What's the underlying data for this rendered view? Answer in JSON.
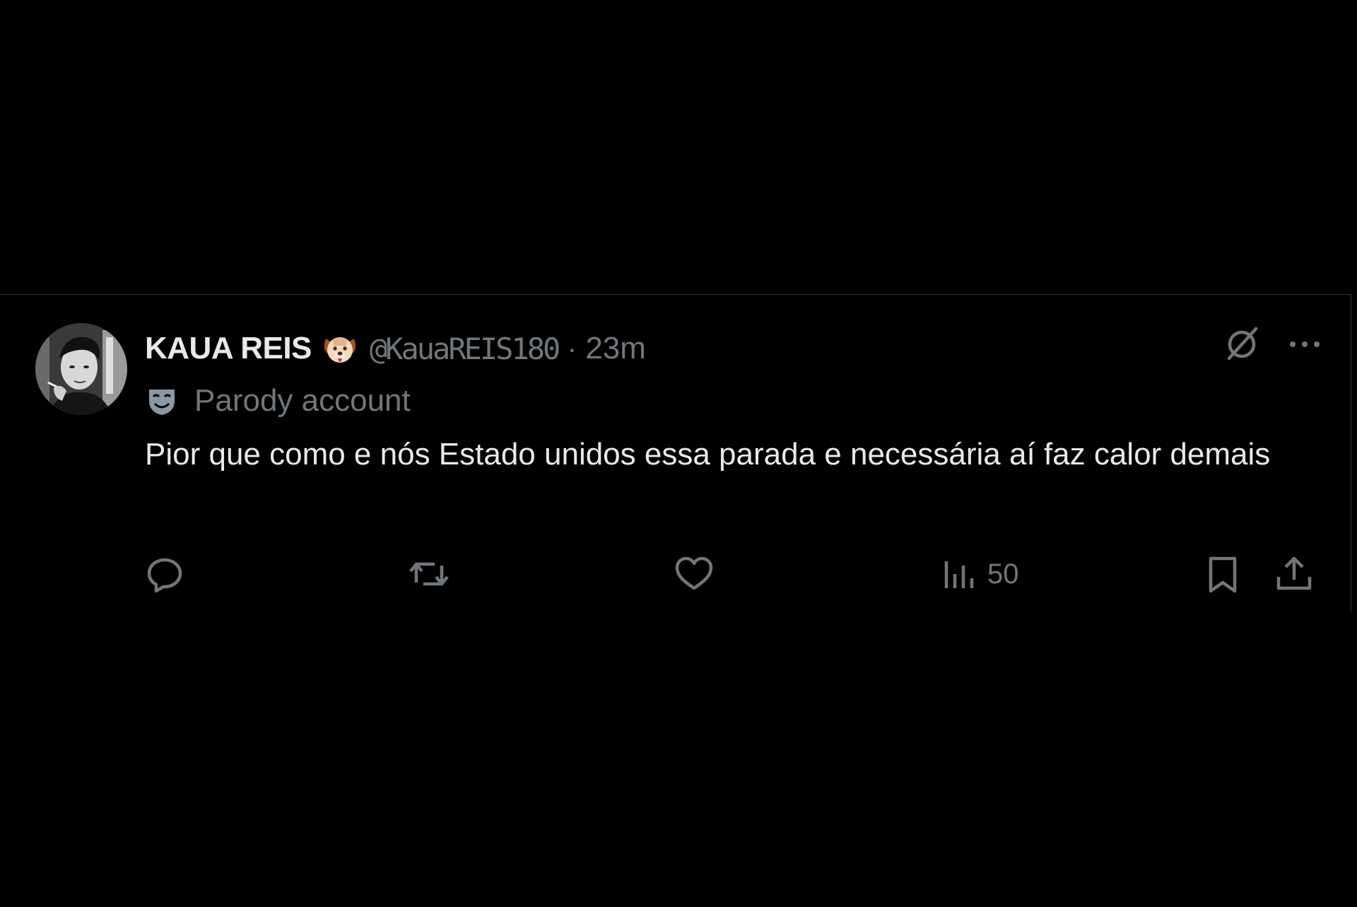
{
  "tweet": {
    "author": {
      "display_name": "KAUA REIS",
      "name_emoji": "dog-face-emoji",
      "handle": "@KauaREIS180",
      "separator": "·",
      "time": "23m",
      "label": "Parody account",
      "label_icon": "parody-mask-icon"
    },
    "text": "Pior que como e nós Estado unidos essa parada e necessária aí faz calor demais",
    "top_actions": [
      "grok-icon",
      "more-icon"
    ],
    "actions": {
      "reply": {
        "icon": "reply-icon",
        "count": ""
      },
      "repost": {
        "icon": "repost-icon",
        "count": ""
      },
      "like": {
        "icon": "like-icon",
        "count": ""
      },
      "views": {
        "icon": "views-icon",
        "count": "50"
      },
      "bookmark": {
        "icon": "bookmark-icon"
      },
      "share": {
        "icon": "share-icon"
      }
    }
  },
  "colors": {
    "background": "#000000",
    "text_primary": "#e7e9ea",
    "text_secondary": "#71767b",
    "border": "#2f3336",
    "parody_icon": "#8b98a5"
  }
}
